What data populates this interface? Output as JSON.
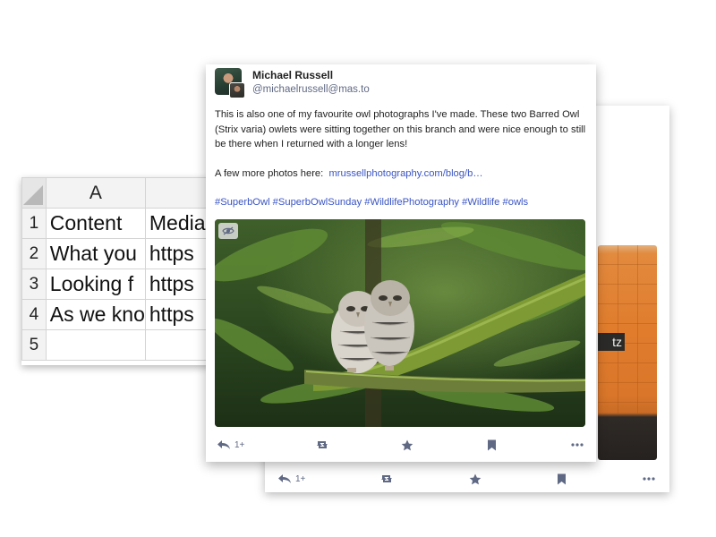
{
  "spreadsheet": {
    "columns": [
      "A",
      ""
    ],
    "rows": [
      {
        "num": "1",
        "a": "Content",
        "b": "Media"
      },
      {
        "num": "2",
        "a": "What you",
        "b": "https"
      },
      {
        "num": "3",
        "a": "Looking f",
        "b": "https"
      },
      {
        "num": "4",
        "a": "As we kno",
        "b": "https"
      },
      {
        "num": "5",
        "a": "",
        "b": ""
      }
    ]
  },
  "back_post": {
    "sign_text": "tz",
    "actions": {
      "reply_count": "1+"
    }
  },
  "post": {
    "display_name": "Michael Russell",
    "handle": "@michaelrussell@mas.to",
    "body": "This is also one of my favourite owl photographs I've made. These two Barred Owl (Strix varia) owlets were sitting together on this branch and were nice enough to still be there when I returned with a longer lens!",
    "more_label": "A few more photos here:",
    "link_text": "mrussellphotography.com/blog/b…",
    "hashtags": "#SuperbOwl #SuperbOwlSunday #WildlifePhotography #Wildlife #owls",
    "actions": {
      "reply_count": "1+"
    }
  },
  "colors": {
    "link": "#3a55c4",
    "muted": "#606984",
    "moss": "#6f9a2e",
    "tile_orange": "#e07c2c"
  },
  "icons": [
    "reply-icon",
    "boost-icon",
    "favourite-icon",
    "bookmark-icon",
    "more-icon",
    "hide-media-icon"
  ]
}
